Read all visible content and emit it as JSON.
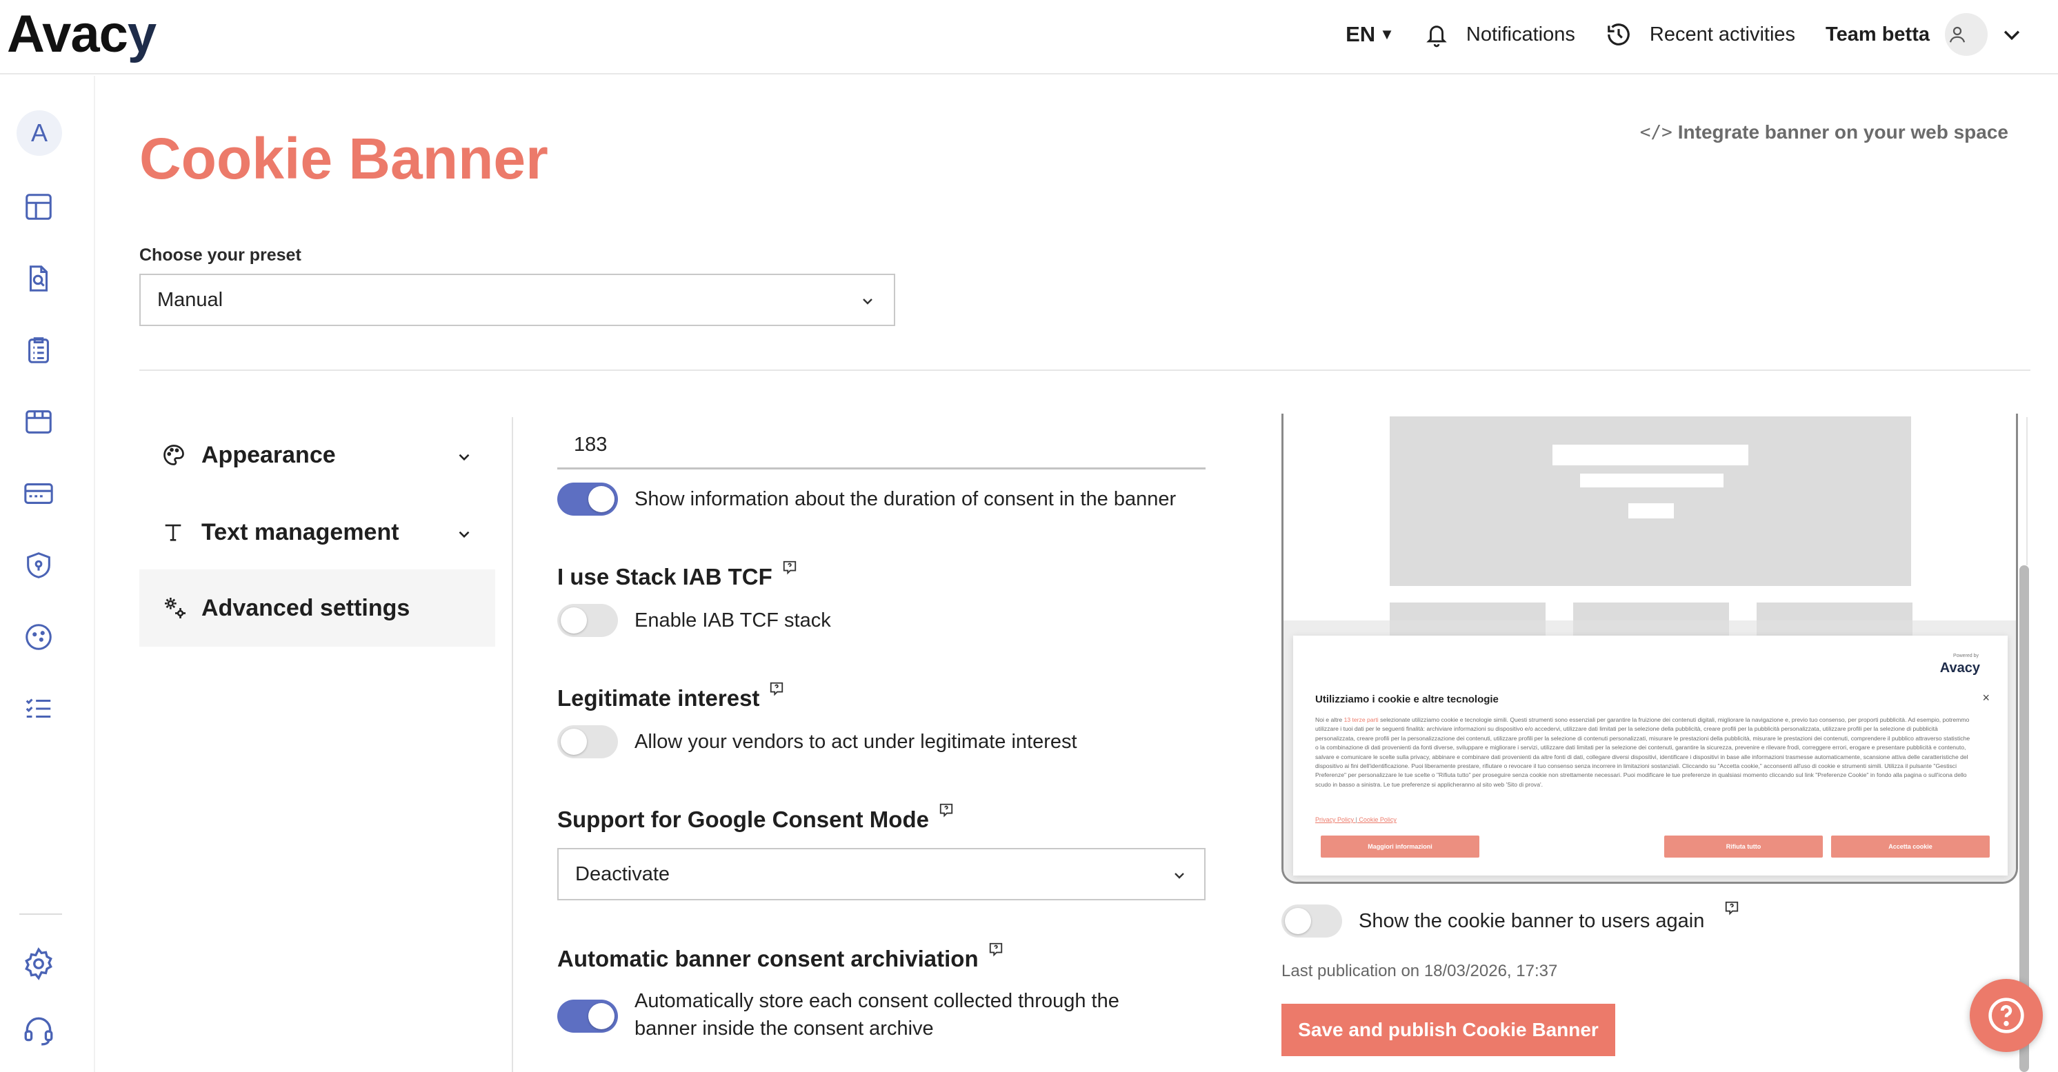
{
  "app": {
    "logo_text_a": "Av",
    "logo_text_b": "ac",
    "logo_text_c": "y"
  },
  "topbar": {
    "language": "EN",
    "notifications_label": "Notifications",
    "recent_label": "Recent activities",
    "team_label": "Team betta",
    "icons": [
      "bell-icon",
      "history-icon",
      "user-icon",
      "chevron-down-icon"
    ]
  },
  "sidebar": {
    "avatar_letter": "A",
    "items": [
      "dashboard-icon",
      "document-search-icon",
      "clipboard-list-icon",
      "box-icon",
      "cookie-banner-icon",
      "shield-icon",
      "cookie-icon",
      "checklist-icon"
    ],
    "bottom_items": [
      "settings-icon",
      "support-headset-icon"
    ]
  },
  "page": {
    "title": "Cookie Banner",
    "integrate_icon": "</>",
    "integrate_label": "Integrate banner on your web space",
    "preset_label": "Choose your preset",
    "preset_value": "Manual"
  },
  "menu": {
    "appearance": "Appearance",
    "text_management": "Text management",
    "advanced_settings": "Advanced settings",
    "active": "Advanced settings"
  },
  "settings": {
    "duration_value": "183",
    "duration_toggle_label": "Show information about the duration of consent in the banner",
    "duration_toggle_on": true,
    "iab_title": "I use Stack IAB TCF",
    "iab_toggle_label": "Enable IAB TCF stack",
    "iab_toggle_on": false,
    "legit_title": "Legitimate interest",
    "legit_toggle_label": "Allow your vendors to act under legitimate interest",
    "legit_toggle_on": false,
    "gcm_title": "Support for Google Consent Mode",
    "gcm_value": "Deactivate",
    "archive_title": "Automatic banner consent archiviation",
    "archive_toggle_label_1": "Automatically store each consent collected through the",
    "archive_toggle_label_2": "banner inside the consent archive",
    "archive_toggle_on": true
  },
  "preview": {
    "powered_by": "Powered by",
    "brand": "Avacy",
    "title": "Utilizziamo i cookie e altre tecnologie",
    "close": "×",
    "text_lead": "Noi e altre ",
    "text_link": "13 terze parti",
    "text_body": " selezionate utilizziamo cookie e tecnologie simili. Questi strumenti sono essenziali per garantire la fruizione dei contenuti digitali, migliorare la navigazione e, previo tuo consenso, per proporti pubblicità. Ad esempio, potremmo utilizzare i tuoi dati per le seguenti finalità: archiviare informazioni su dispositivo e/o accedervi, utilizzare dati limitati per la selezione della pubblicità, creare profili per la pubblicità personalizzata, utilizzare profili per la selezione di pubblicità personalizzata, creare profili per la personalizzazione dei contenuti, utilizzare profili per la selezione di contenuti personalizzati, misurare le prestazioni della pubblicità, misurare le prestazioni dei contenuti, comprendere il pubblico attraverso statistiche o la combinazione di dati provenienti da fonti diverse, sviluppare e migliorare i servizi, utilizzare dati limitati per la selezione dei contenuti, garantire la sicurezza, prevenire e rilevare frodi, correggere errori, erogare e presentare pubblicità e contenuto, salvare e comunicare le scelte sulla privacy, abbinare e combinare dati provenienti da altre fonti di dati, collegare diversi dispositivi, identificare i dispositivi in base alle informazioni trasmesse automaticamente, scansione attiva delle caratteristiche del dispositivo ai fini dell'identificazione. Puoi liberamente prestare, rifiutare o revocare il tuo consenso senza incorrere in limitazioni sostanziali. Cliccando su \"Accetta cookie,\" acconsenti all'uso di cookie e strumenti simili. Utilizza il pulsante \"Gestisci Preferenze\" per personalizzare le tue scelte o \"Rifiuta tutto\" per proseguire senza cookie non strettamente necessari. Puoi modificare le tue preferenze in qualsiasi momento cliccando sul link \"Preferenze Cookie\" in fondo alla pagina o sull'icona dello scudo in basso a sinistra. Le tue preferenze si applicheranno al sito web 'Sito di prova'.",
    "privacy_link": "Privacy Policy",
    "link_sep": "|",
    "cookie_link": "Cookie Policy",
    "btn_more": "Maggiori informazioni",
    "btn_reject": "Rifiuta tutto",
    "btn_accept": "Accetta cookie"
  },
  "publish": {
    "show_again_label": "Show the cookie banner to users again",
    "show_again_on": false,
    "last_publication": "Last publication on 18/03/2026, 17:37",
    "save_button": "Save and publish Cookie Banner"
  },
  "colors": {
    "accent": "#ec7a6a",
    "toggle_on": "#5d6fc2",
    "brand_dark": "#1e2c4a"
  }
}
